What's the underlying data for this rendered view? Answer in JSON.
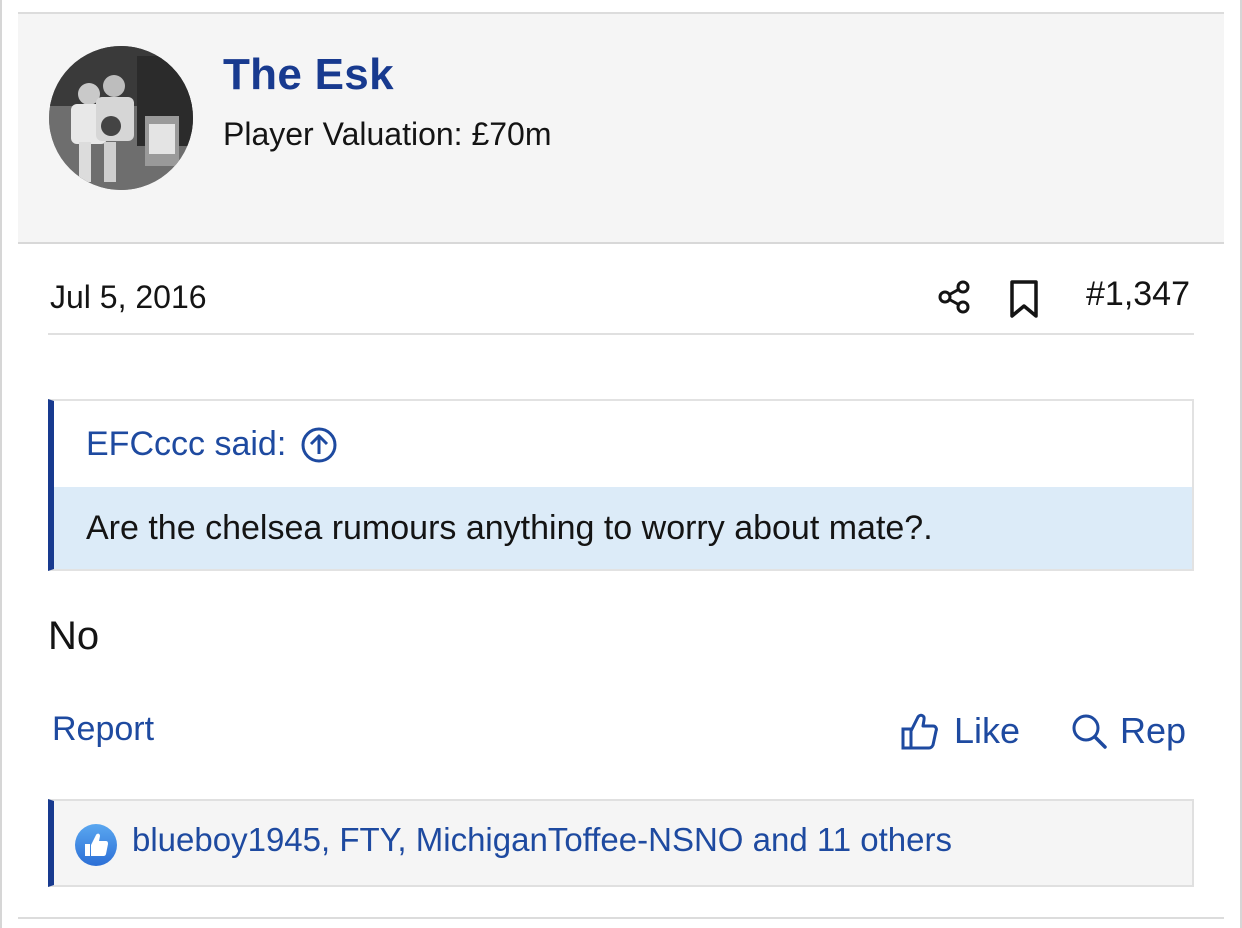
{
  "user": {
    "name": "The Esk",
    "title": "Player Valuation: £70m",
    "avatar_icon": "avatar-photo"
  },
  "post": {
    "date": "Jul 5, 2016",
    "number": "#1,347",
    "share_icon": "share-icon",
    "bookmark_icon": "bookmark-icon",
    "body": "No"
  },
  "quote": {
    "attribution": "EFCccc said:",
    "text": "Are the chelsea rumours anything to worry about mate?.",
    "jump_icon": "arrow-up-circle-icon"
  },
  "actions": {
    "report": "Report",
    "like": "Like",
    "reply": "Rep",
    "like_icon": "thumbs-up-icon",
    "reply_icon": "search-icon"
  },
  "reactions": {
    "text": "blueboy1945, FTY, MichiganToffee-NSNO and 11 others",
    "icon": "like-reaction-icon"
  },
  "colors": {
    "accent": "#183a8f",
    "link": "#1e4aa0",
    "quote_bg": "#dcebf8",
    "header_bg": "#f5f5f5"
  }
}
